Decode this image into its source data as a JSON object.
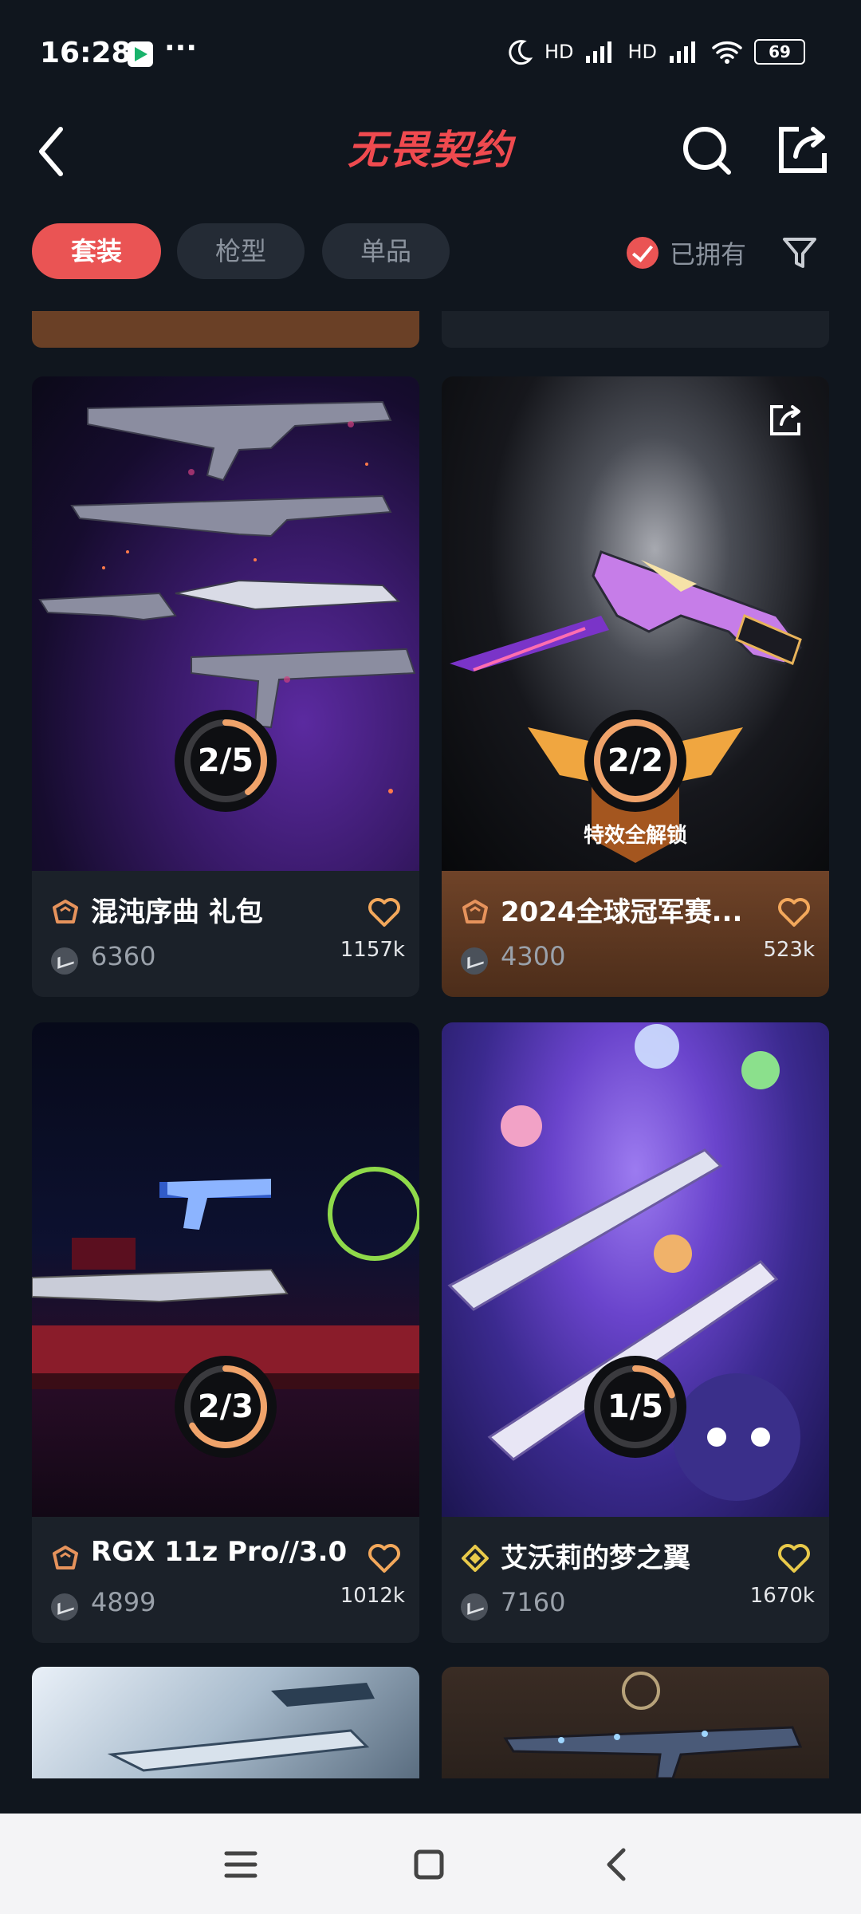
{
  "status_bar": {
    "time": "16:28",
    "more": "···",
    "signal_1": "HD",
    "signal_2": "HD",
    "battery": "69"
  },
  "header": {
    "title": "无畏契约"
  },
  "filters": {
    "tabs": [
      {
        "label": "套装",
        "active": true
      },
      {
        "label": "枪型",
        "active": false
      },
      {
        "label": "单品",
        "active": false
      }
    ],
    "owned_label": "已拥有"
  },
  "cards": [
    {
      "name": "混沌序曲 礼包",
      "price": "6360",
      "likes": "1157k",
      "progress": "2/5",
      "progress_fraction": 0.4,
      "style": "dark",
      "tier_color": "#e6935c"
    },
    {
      "name": "2024全球冠军赛...",
      "price": "4300",
      "likes": "523k",
      "progress": "2/2",
      "progress_fraction": 1.0,
      "style": "gold",
      "tier_color": "#e6935c",
      "badge": "特效全解锁"
    },
    {
      "name": "RGX 11z Pro//3.0",
      "price": "4899",
      "likes": "1012k",
      "progress": "2/3",
      "progress_fraction": 0.667,
      "style": "dark",
      "tier_color": "#e6935c"
    },
    {
      "name": "艾沃莉的梦之翼",
      "price": "7160",
      "likes": "1670k",
      "progress": "1/5",
      "progress_fraction": 0.2,
      "style": "dark",
      "tier_color": "#e8c94a"
    }
  ],
  "colors": {
    "accent": "#ea5454",
    "ring": "#f0a36a",
    "heart": "#f3a85b"
  }
}
